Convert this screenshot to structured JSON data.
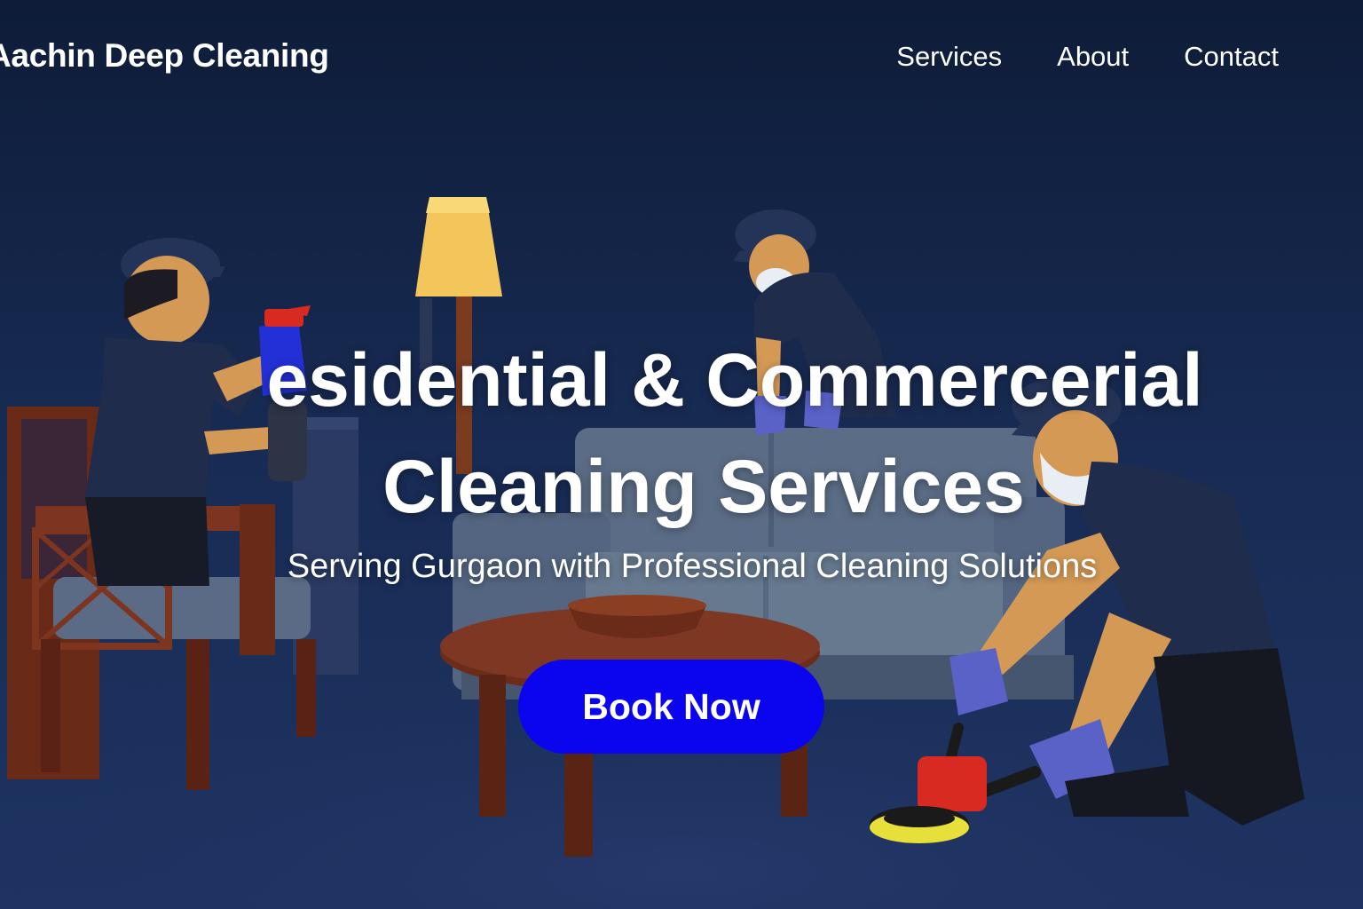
{
  "header": {
    "logo_text": "Aachin Deep Cleaning",
    "nav": [
      {
        "label": "Services"
      },
      {
        "label": "About"
      },
      {
        "label": "Contact"
      }
    ]
  },
  "hero": {
    "title_line1": "esidential & Commercerial",
    "title_line2": "Cleaning Services",
    "subtitle": "Serving Gurgaon with Professional Cleaning Solutions",
    "cta_label": "Book Now"
  },
  "colors": {
    "background": "#152850",
    "cta": "#0a05ee",
    "uniform": "#1c2a4a"
  }
}
